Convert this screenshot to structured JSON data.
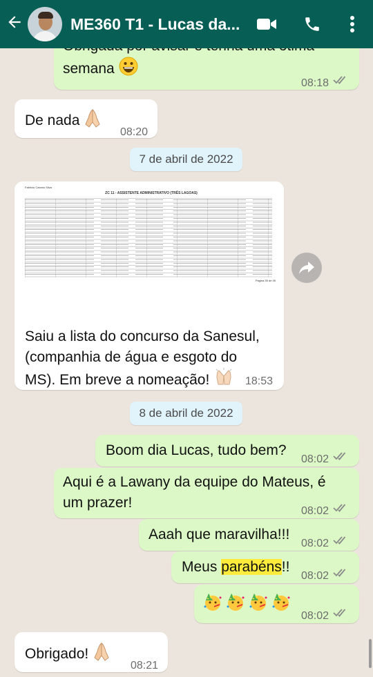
{
  "header": {
    "title": "ME360 T1 - Lucas da...",
    "back_label": "←",
    "colors": {
      "header_bg": "#075e54",
      "chat_bg": "#ece5dd",
      "incoming": "#ffffff",
      "outgoing": "#dcf8c6"
    }
  },
  "messages": {
    "m1": {
      "text": "Obrigada por avisar e tenha uma ótima semana",
      "time": "08:18"
    },
    "m2": {
      "text": "De nada",
      "time": "08:20"
    },
    "d1": "7 de abril de 2022",
    "m3": {
      "text_line1": "Saiu a lista do concurso da Sanesul,",
      "text_line2": "(companhia de água e esgoto do",
      "text_line3": "MS). Em breve a nomeação!",
      "time": "18:53",
      "doc_heading": "ZC 11 - ASSISTENTE ADMINISTRATIVO (TRÊS LAGOAS)",
      "doc_top_row": "Fabricio Catonio Silva",
      "doc_footer": "Página 35 de 45"
    },
    "d2": "8 de abril de 2022",
    "m4": {
      "text": "Boom dia Lucas, tudo bem?",
      "time": "08:02"
    },
    "m5": {
      "text_line1": "Aqui é a Lawany da equipe do Mateus, é",
      "text_line2": "um prazer!",
      "time": "08:02"
    },
    "m6": {
      "text": "Aaah que maravilha!!!",
      "time": "08:02"
    },
    "m7": {
      "text_before": "Meus ",
      "text_highlight": "parabéns",
      "text_after": "!!",
      "time": "08:02"
    },
    "m8": {
      "time": "08:02"
    },
    "m9": {
      "text": "Obrigado!",
      "time": "08:21"
    }
  },
  "icons": [
    "back-arrow-icon",
    "avatar",
    "video-call-icon",
    "phone-icon",
    "menu-dots-icon",
    "forward-icon",
    "read-receipt-icon",
    "smiley-emoji-icon",
    "pray-emoji-icon",
    "party-face-emoji-icon"
  ]
}
